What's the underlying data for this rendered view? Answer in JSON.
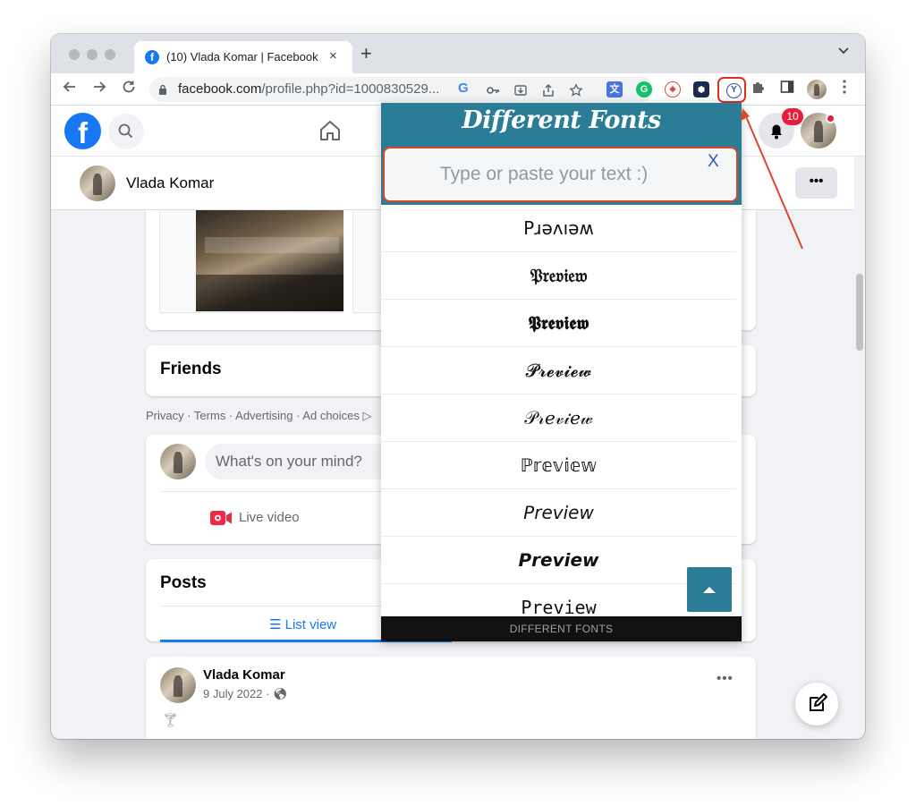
{
  "browser": {
    "tab_title": "(10) Vlada Komar | Facebook",
    "tab_close": "×",
    "new_tab": "+",
    "url_host": "facebook.com",
    "url_path": "/profile.php?id=1000830529...",
    "tab_menu": "⌄"
  },
  "header": {
    "notification_count": "10",
    "logo_letter": "f"
  },
  "profile": {
    "name": "Vlada Komar",
    "more": "•••"
  },
  "content": {
    "friends_title": "Friends",
    "footer_links": "Privacy · Terms · Advertising · Ad choices ▷",
    "composer_placeholder": "What's on your mind?",
    "live_video": "Live video",
    "posts_title": "Posts",
    "list_view": "☰ List view",
    "post_author": "Vlada Komar",
    "post_date": "9 July 2022 · 🌎︎",
    "post_more": "•••",
    "post_glass": "🍸︎"
  },
  "popup": {
    "title": "Different Fonts",
    "input_placeholder": "Type or paste your text :)",
    "close": "X",
    "previews": [
      {
        "text": "Pɹǝʌıǝʍ"
      },
      {
        "text": "𝔓𝔯𝔢𝔳𝔦𝔢𝔴"
      },
      {
        "text": "𝕻𝖗𝖊𝖛𝖎𝖊𝖜"
      },
      {
        "text": "𝓟𝓻𝓮𝓿𝓲𝓮𝔀"
      },
      {
        "text": "𝒫𝓇𝑒𝓋𝒾𝑒𝓌"
      },
      {
        "text": "ℙ𝕣𝕖𝕧𝕚𝕖𝕨"
      },
      {
        "text": "𝘗𝘳𝘦𝘷𝘪𝘦𝘸"
      },
      {
        "text": "𝙋𝙧𝙚𝙫𝙞𝙚𝙬"
      },
      {
        "text": "𝙿𝚛𝚎𝚟𝚒𝚎𝚠"
      }
    ],
    "footer": "DIFFERENT FONTS"
  },
  "colors": {
    "facebook_blue": "#1877f2",
    "popup_teal": "#2a7d94",
    "highlight_red": "#d93025"
  },
  "icons": {
    "back": "arrow-left-icon",
    "forward": "arrow-right-icon",
    "reload": "reload-icon",
    "lock": "lock-icon",
    "star": "star-icon",
    "extensions": "puzzle-icon"
  }
}
